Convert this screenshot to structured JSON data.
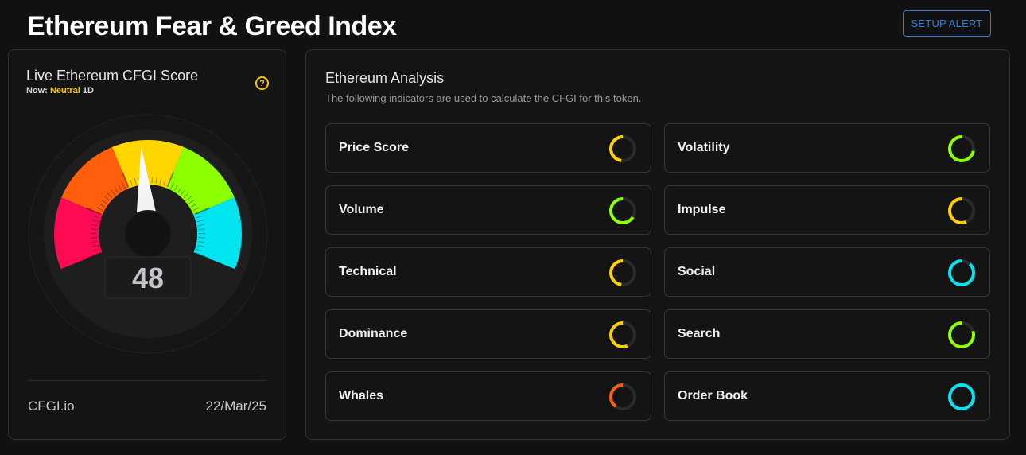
{
  "header": {
    "title": "Ethereum Fear & Greed Index",
    "alert_button": "SETUP ALERT"
  },
  "score_card": {
    "title": "Live Ethereum CFGI Score",
    "now_label": "Now:",
    "sentiment": "Neutral",
    "timeframe": "1D",
    "help_icon": "?",
    "score": "48",
    "score_value": 48,
    "score_range": [
      0,
      100
    ],
    "zones": [
      {
        "name": "extreme-fear",
        "color": "#ff0a54"
      },
      {
        "name": "fear",
        "color": "#ff5e0a"
      },
      {
        "name": "neutral",
        "color": "#ffd600"
      },
      {
        "name": "greed",
        "color": "#8cff00"
      },
      {
        "name": "extreme-greed",
        "color": "#00e5f0"
      }
    ],
    "footer_brand": "CFGI.io",
    "footer_date": "22/Mar/25"
  },
  "analysis": {
    "title": "Ethereum Analysis",
    "subtitle": "The following indicators are used to calculate the CFGI for this token.",
    "indicators": [
      {
        "label": "Price Score",
        "value": 0.48,
        "color": "#ffd000"
      },
      {
        "label": "Volatility",
        "value": 0.72,
        "color": "#8cff00"
      },
      {
        "label": "Volume",
        "value": 0.66,
        "color": "#8cff00"
      },
      {
        "label": "Impulse",
        "value": 0.56,
        "color": "#ffd000"
      },
      {
        "label": "Technical",
        "value": 0.48,
        "color": "#ffd000"
      },
      {
        "label": "Social",
        "value": 0.88,
        "color": "#00e5f0"
      },
      {
        "label": "Dominance",
        "value": 0.56,
        "color": "#ffd000"
      },
      {
        "label": "Search",
        "value": 0.8,
        "color": "#8cff00"
      },
      {
        "label": "Whales",
        "value": 0.4,
        "color": "#ff5e0a"
      },
      {
        "label": "Order Book",
        "value": 1.0,
        "color": "#00e5f0"
      }
    ]
  }
}
